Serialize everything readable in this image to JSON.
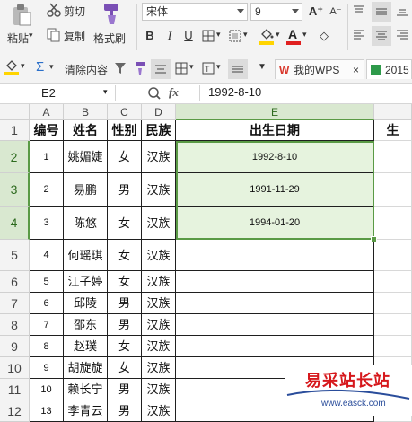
{
  "toolbar": {
    "cut": "剪切",
    "paste": "粘贴",
    "copy": "复制",
    "format_painter": "格式刷",
    "font_name": "宋体",
    "font_size": "9",
    "bold": "B",
    "italic": "I",
    "underline": "U",
    "font_color_letter": "A",
    "grow_font": "A⁺",
    "shrink_font": "A⁻",
    "sum": "Σ",
    "clear": "清除内容",
    "fill_color": "#ffd400",
    "font_color": "#e02020"
  },
  "tabs": [
    {
      "label": "我的WPS",
      "icon": "wps-icon",
      "close": "×"
    },
    {
      "label": "2015",
      "icon": "sheet-icon"
    }
  ],
  "formula_bar": {
    "cell_ref": "E2",
    "fx": "fx",
    "value": "1992-8-10"
  },
  "columns": [
    "A",
    "B",
    "C",
    "D",
    "E"
  ],
  "rows": [
    "1",
    "2",
    "3",
    "4",
    "5",
    "6",
    "7",
    "8",
    "9",
    "10",
    "11",
    "12"
  ],
  "header_row": {
    "a": "编号",
    "b": "姓名",
    "c": "性别",
    "d": "民族",
    "e": "出生日期",
    "f": "生"
  },
  "data": [
    {
      "a": "1",
      "b": "姚媚婕",
      "c": "女",
      "d": "汉族",
      "e": "1992-8-10"
    },
    {
      "a": "2",
      "b": "易鹏",
      "c": "男",
      "d": "汉族",
      "e": "1991-11-29"
    },
    {
      "a": "3",
      "b": "陈悠",
      "c": "女",
      "d": "汉族",
      "e": "1994-01-20"
    },
    {
      "a": "4",
      "b": "何瑶琪",
      "c": "女",
      "d": "汉族",
      "e": ""
    },
    {
      "a": "5",
      "b": "江子婷",
      "c": "女",
      "d": "汉族",
      "e": ""
    },
    {
      "a": "6",
      "b": "邱陵",
      "c": "男",
      "d": "汉族",
      "e": ""
    },
    {
      "a": "7",
      "b": "邵东",
      "c": "男",
      "d": "汉族",
      "e": ""
    },
    {
      "a": "8",
      "b": "赵璞",
      "c": "女",
      "d": "汉族",
      "e": ""
    },
    {
      "a": "9",
      "b": "胡旋旋",
      "c": "女",
      "d": "汉族",
      "e": ""
    },
    {
      "a": "10",
      "b": "赖长宁",
      "c": "男",
      "d": "汉族",
      "e": ""
    },
    {
      "a": "13",
      "b": "李青云",
      "c": "男",
      "d": "汉族",
      "e": ""
    }
  ],
  "watermark": {
    "title": "易采站长站",
    "url": "www.easck.com"
  }
}
